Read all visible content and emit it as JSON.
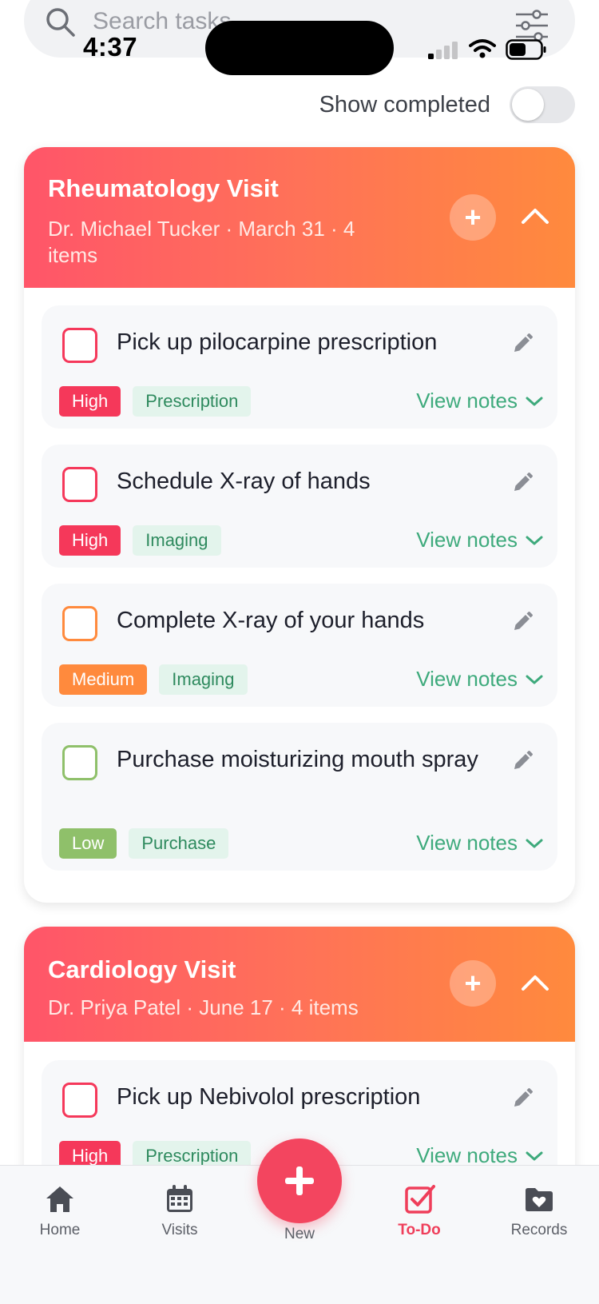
{
  "status_bar": {
    "time": "4:37"
  },
  "search": {
    "placeholder": "Search tasks"
  },
  "filters": {
    "show_completed_label": "Show completed",
    "show_completed_on": false
  },
  "colors": {
    "high": "#f5385a",
    "medium": "#ff8a3d",
    "low": "#8fc06a",
    "accent_green": "#3eaa7c",
    "accent_red": "#f3455f"
  },
  "visits": [
    {
      "title": "Rheumatology Visit",
      "subtitle_line1": "Dr. Michael Tucker  ·  March 31 · 4",
      "subtitle_line2": "items",
      "tasks": [
        {
          "title": "Pick up pilocarpine prescription",
          "priority": "High",
          "category": "Prescription",
          "notes_label": "View notes"
        },
        {
          "title": "Schedule X-ray of hands",
          "priority": "High",
          "category": "Imaging",
          "notes_label": "View notes"
        },
        {
          "title": "Complete X-ray of your hands",
          "priority": "Medium",
          "category": "Imaging",
          "notes_label": "View notes"
        },
        {
          "title": "Purchase moisturizing mouth spray",
          "priority": "Low",
          "category": "Purchase",
          "notes_label": "View notes"
        }
      ]
    },
    {
      "title": "Cardiology Visit",
      "subtitle_line1": "Dr. Priya Patel  ·  June 17 · 4 items",
      "tasks": [
        {
          "title": "Pick up Nebivolol prescription",
          "priority": "High",
          "category": "Prescription",
          "notes_label": "View notes"
        }
      ]
    }
  ],
  "nav": {
    "items": [
      {
        "label": "Home",
        "icon": "home-icon"
      },
      {
        "label": "Visits",
        "icon": "calendar-icon"
      },
      {
        "label": "New",
        "icon": "plus-icon"
      },
      {
        "label": "To-Do",
        "icon": "checklist-icon",
        "active": true
      },
      {
        "label": "Records",
        "icon": "folder-heart-icon"
      }
    ]
  }
}
